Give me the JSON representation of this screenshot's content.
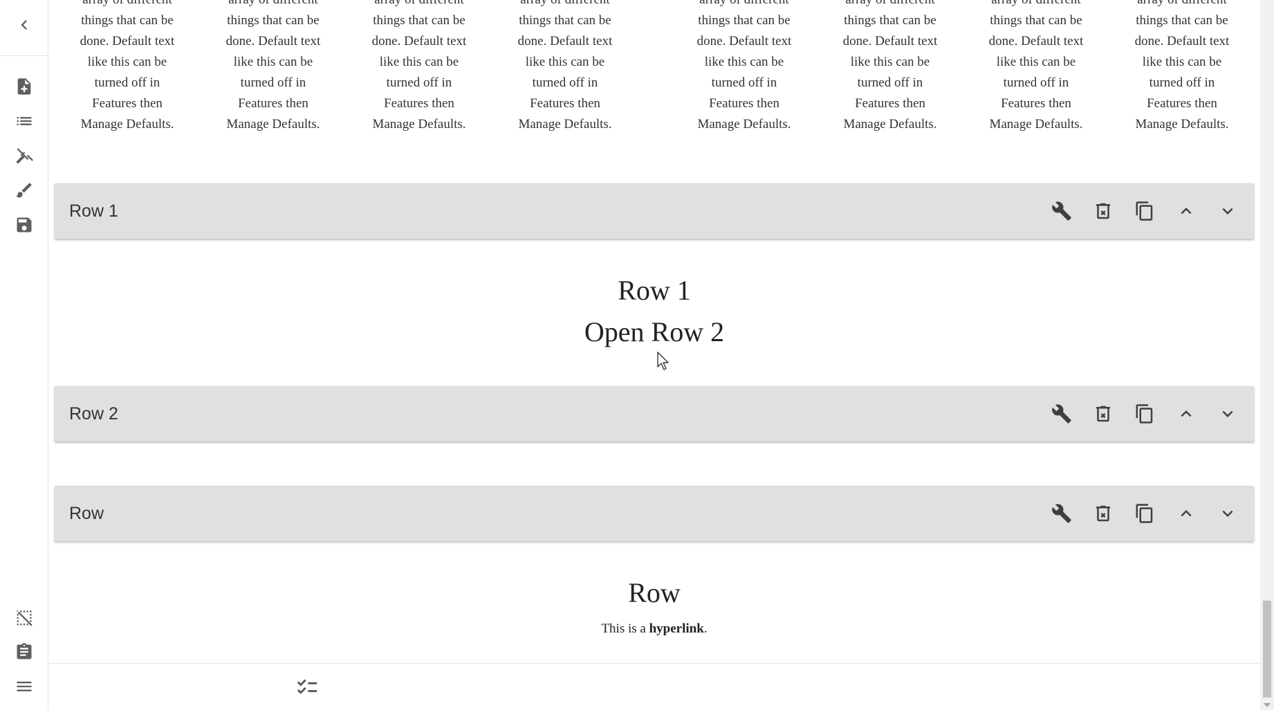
{
  "sidebar": {
    "items": [
      {
        "name": "collapse",
        "icon": "chevron-left-icon"
      },
      {
        "name": "add-page",
        "icon": "note-add-icon"
      },
      {
        "name": "outline",
        "icon": "list-icon"
      },
      {
        "name": "features",
        "icon": "tools-icon"
      },
      {
        "name": "design",
        "icon": "brush-icon"
      },
      {
        "name": "save",
        "icon": "floppy-disk-icon"
      },
      {
        "name": "hide-guides",
        "icon": "select-off-icon"
      },
      {
        "name": "clipboard",
        "icon": "clipboard-icon"
      },
      {
        "name": "menu",
        "icon": "hamburger-menu-icon"
      }
    ]
  },
  "default_columns": {
    "lines": [
      "array of different",
      "things that can be",
      "done. Default text",
      "like this can be",
      "turned off in",
      "Features then",
      "Manage Defaults."
    ]
  },
  "rows": [
    {
      "title": "Row 1",
      "heading": "Row 1",
      "subheading": "Open Row 2"
    },
    {
      "title": "Row 2"
    },
    {
      "title": "Row",
      "heading": "Row",
      "para_prefix": "This is a ",
      "para_link": "hyperlink",
      "para_suffix": "."
    }
  ],
  "row_tools": [
    "wrench-icon",
    "delete-icon",
    "copy-icon",
    "chevron-up-icon",
    "chevron-down-icon"
  ],
  "bottom_bar": {
    "icon": "checklist-icon"
  },
  "colors": {
    "row_bar_bg": "#e0e0e0",
    "icon": "#3f3f3f",
    "sidebar_icon": "#5f5f5f"
  }
}
